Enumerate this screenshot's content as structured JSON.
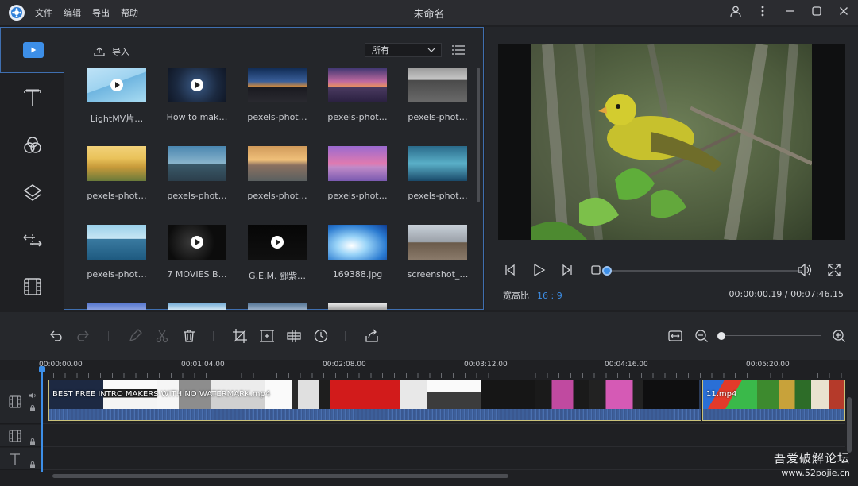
{
  "app": {
    "title": "未命名",
    "menus": [
      "文件",
      "编辑",
      "导出",
      "帮助"
    ]
  },
  "rail": {
    "items": [
      {
        "name": "media",
        "icon": "play-icon",
        "active": true
      },
      {
        "name": "text",
        "icon": "text-icon"
      },
      {
        "name": "filters",
        "icon": "filter-circles-icon"
      },
      {
        "name": "overlays",
        "icon": "layers-icon"
      },
      {
        "name": "transitions",
        "icon": "transition-arrows-icon"
      },
      {
        "name": "elements",
        "icon": "film-icon"
      }
    ]
  },
  "library": {
    "import_label": "导入",
    "filter_value": "所有",
    "items": [
      {
        "label": "LightMV片…",
        "video": true
      },
      {
        "label": "How to mak…",
        "video": true
      },
      {
        "label": "pexels-phot…"
      },
      {
        "label": "pexels-phot…"
      },
      {
        "label": "pexels-phot…"
      },
      {
        "label": "pexels-phot…"
      },
      {
        "label": "pexels-phot…"
      },
      {
        "label": "pexels-phot…"
      },
      {
        "label": "pexels-phot…"
      },
      {
        "label": "pexels-phot…"
      },
      {
        "label": "pexels-phot…"
      },
      {
        "label": "7 MOVIES B…",
        "video": true
      },
      {
        "label": "G.E.M. 鄧紫…",
        "video": true
      },
      {
        "label": "169388.jpg"
      },
      {
        "label": "screenshot_…"
      }
    ]
  },
  "preview": {
    "aspect_label": "宽高比",
    "aspect_value": "16 : 9",
    "timecode": "00:00:00.19 / 00:07:46.15",
    "progress": 0.0
  },
  "timeline": {
    "ruler": [
      "00:00:00.00",
      "00:01:04.00",
      "00:02:08.00",
      "00:03:12.00",
      "00:04:16.00",
      "00:05:20.00"
    ],
    "clips": [
      {
        "label": "BEST FREE INTRO MAKERS WITH NO WATERMARK.mp4"
      },
      {
        "label": "11.mp4"
      }
    ]
  },
  "watermark": {
    "line1": "吾爱破解论坛",
    "line2": "www.52pojie.cn"
  },
  "colors": {
    "accent": "#3d8fe8",
    "panel_border": "#3f6fb0",
    "clip_border": "#c9c17a"
  }
}
